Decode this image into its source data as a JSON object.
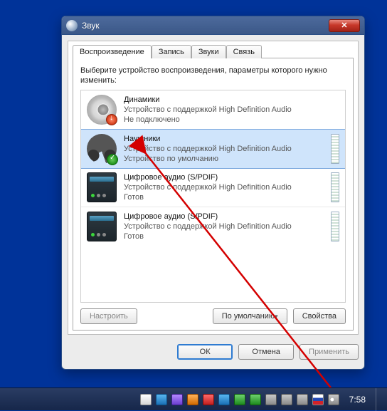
{
  "window": {
    "title": "Звук"
  },
  "tabs": [
    {
      "label": "Воспроизведение",
      "active": true
    },
    {
      "label": "Запись"
    },
    {
      "label": "Звуки"
    },
    {
      "label": "Связь"
    }
  ],
  "instruction": "Выберите устройство воспроизведения, параметры которого нужно изменить:",
  "devices": [
    {
      "name": "Динамики",
      "desc": "Устройство с поддержкой High Definition Audio",
      "status": "Не подключено"
    },
    {
      "name": "Наушники",
      "desc": "Устройство с поддержкой High Definition Audio",
      "status": "Устройство по умолчанию",
      "selected": true
    },
    {
      "name": "Цифровое аудио (S/PDIF)",
      "desc": "Устройство с поддержкой High Definition Audio",
      "status": "Готов"
    },
    {
      "name": "Цифровое аудио (S/PDIF)",
      "desc": "Устройство с поддержкой High Definition Audio",
      "status": "Готов"
    }
  ],
  "panel_buttons": {
    "configure": "Настроить",
    "default": "По умолчанию",
    "properties": "Свойства"
  },
  "dialog_buttons": {
    "ok": "ОК",
    "cancel": "Отмена",
    "apply": "Применить"
  },
  "taskbar": {
    "clock": "7:58"
  }
}
